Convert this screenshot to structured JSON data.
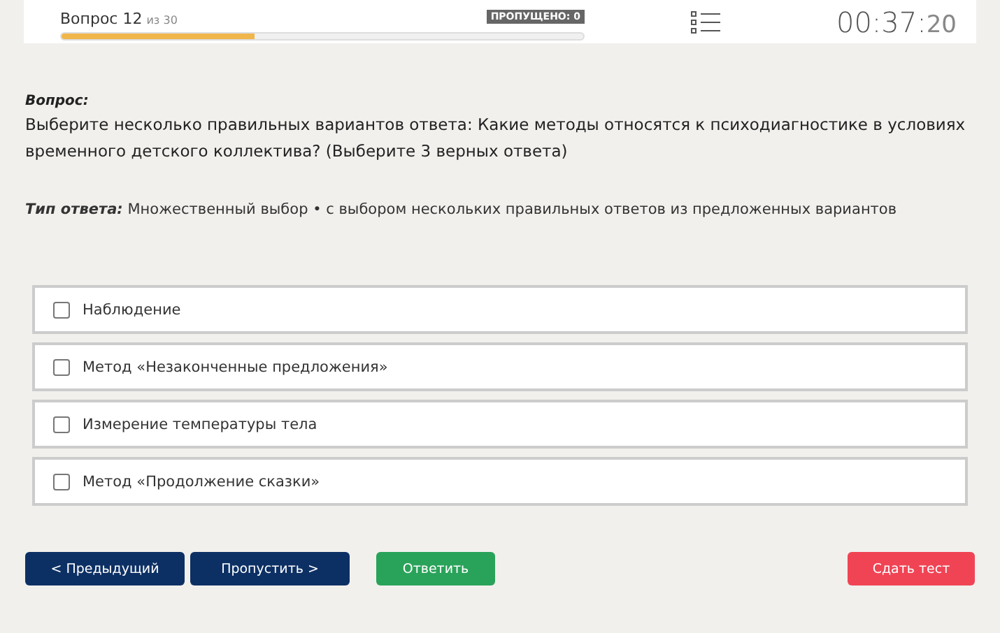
{
  "header": {
    "question_label": "Вопрос 12",
    "question_total": "из 30",
    "skipped_badge": "ПРОПУЩЕНО: 0",
    "progress": {
      "level": 0.37
    },
    "timer_main": "00:37:",
    "timer_seconds": "20"
  },
  "question": {
    "label": "Вопрос:",
    "text": "Выберите несколько правильных вариантов ответа: Какие методы относятся к психодиагностике в условиях временного детского коллектива? (Выберите 3 верных ответа)"
  },
  "answer_type": {
    "label": "Тип ответа:",
    "text": "Множественный выбор • с выбором нескольких правильных ответов из предложенных вариантов"
  },
  "options": [
    {
      "label": "Наблюдение",
      "checked": false
    },
    {
      "label": "Метод «Незаконченные предложения»",
      "checked": false
    },
    {
      "label": "Измерение температуры тела",
      "checked": false
    },
    {
      "label": "Метод «Продолжение сказки»",
      "checked": false
    }
  ],
  "buttons": [
    {
      "label": "< Предыдущий",
      "kind": "nav"
    },
    {
      "label": "Пропустить >",
      "kind": "nav"
    },
    {
      "label": "Ответить",
      "kind": "answer"
    },
    {
      "label": "Сдать тест",
      "kind": "finish"
    }
  ]
}
